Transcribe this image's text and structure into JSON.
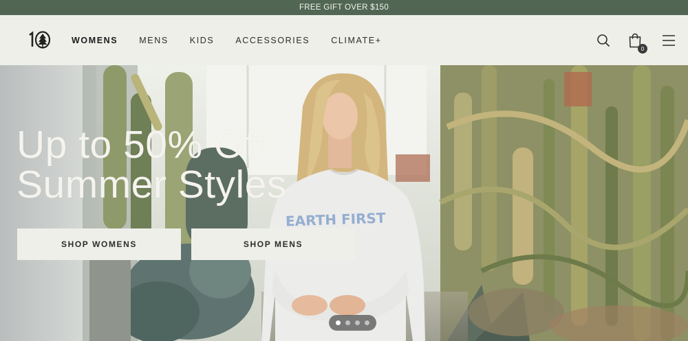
{
  "promo": {
    "text": "FREE GIFT OVER $150"
  },
  "header": {
    "logo_text": "10",
    "nav": [
      {
        "label": "WOMENS",
        "active": true
      },
      {
        "label": "MENS"
      },
      {
        "label": "KIDS"
      },
      {
        "label": "ACCESSORIES"
      },
      {
        "label": "CLIMATE+"
      }
    ],
    "icons": [
      "search-icon",
      "shopping-bag-icon",
      "hamburger-menu-icon"
    ],
    "bag_count": "0"
  },
  "hero": {
    "title_line1": "Up to 50% Off",
    "title_line2": "Summer Styles",
    "buttons": {
      "shop_womens": "SHOP WOMENS",
      "shop_mens": "SHOP MENS"
    },
    "sweatshirt_text": "EARTH FIRST",
    "carousel": {
      "total": 4,
      "active_index": 1
    }
  },
  "colors": {
    "promo_bg": "#516753",
    "header_bg": "#efefea",
    "hero_title": "#f5f3ee",
    "button_bg": "#efefea"
  }
}
